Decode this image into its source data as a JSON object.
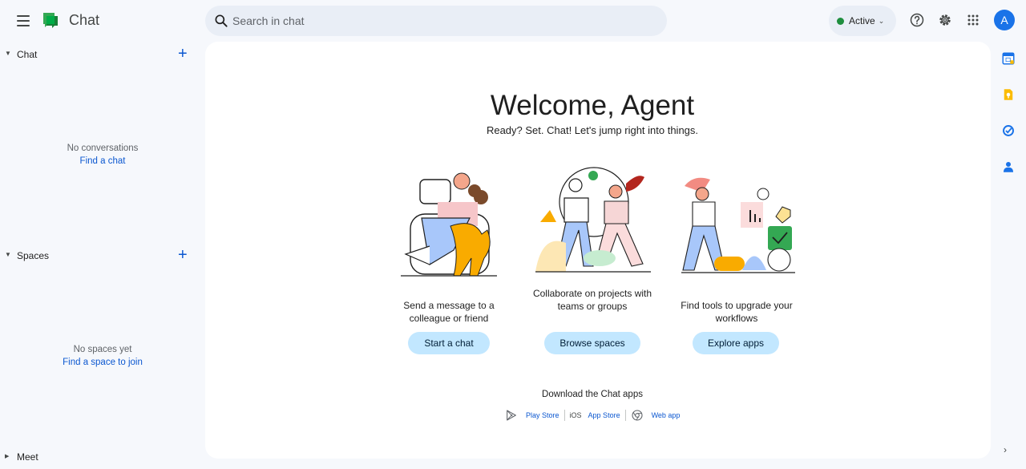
{
  "header": {
    "app_title": "Chat",
    "search_placeholder": "Search in chat",
    "status_label": "Active",
    "avatar_initial": "A",
    "icons": [
      "menu-icon",
      "chat-logo",
      "search-icon",
      "help-icon",
      "settings-icon",
      "apps-grid-icon"
    ]
  },
  "sidebar": {
    "chat": {
      "title": "Chat",
      "empty_text": "No conversations",
      "empty_link": "Find a chat"
    },
    "spaces": {
      "title": "Spaces",
      "empty_text": "No spaces yet",
      "empty_link": "Find a space to join"
    },
    "meet": {
      "title": "Meet"
    }
  },
  "main": {
    "welcome": "Welcome, Agent",
    "subtitle": "Ready? Set. Chat! Let's jump right into things.",
    "features": [
      {
        "text": "Send a message to a colleague or friend",
        "button": "Start a chat"
      },
      {
        "text": "Collaborate on projects with teams or groups",
        "button": "Browse spaces"
      },
      {
        "text": "Find tools to upgrade your workflows",
        "button": "Explore apps"
      }
    ],
    "download_title": "Download the Chat apps",
    "stores": {
      "play": "Play Store",
      "ios_tag": "iOS",
      "app_store": "App Store",
      "web": "Web app"
    }
  },
  "right_rail": [
    "calendar-icon",
    "keep-icon",
    "tasks-icon",
    "contacts-icon",
    "chevron-right-icon"
  ],
  "colors": {
    "accent": "#0b57d0",
    "pill": "#c2e7ff",
    "status_green": "#1e8e3e",
    "page_bg": "#f6f8fc"
  }
}
